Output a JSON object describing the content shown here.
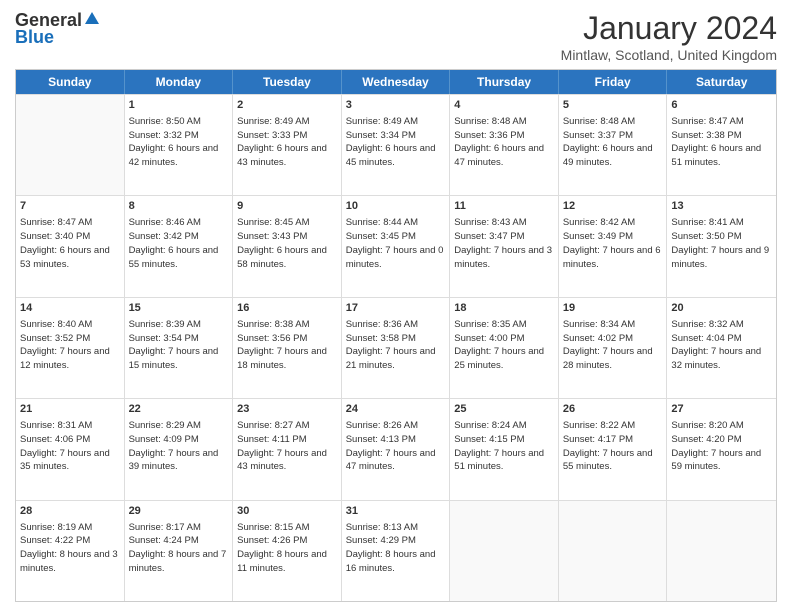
{
  "header": {
    "logo_general": "General",
    "logo_blue": "Blue",
    "month_title": "January 2024",
    "subtitle": "Mintlaw, Scotland, United Kingdom"
  },
  "days": [
    "Sunday",
    "Monday",
    "Tuesday",
    "Wednesday",
    "Thursday",
    "Friday",
    "Saturday"
  ],
  "weeks": [
    [
      {
        "num": "",
        "empty": true
      },
      {
        "num": "1",
        "sunrise": "Sunrise: 8:50 AM",
        "sunset": "Sunset: 3:32 PM",
        "daylight": "Daylight: 6 hours and 42 minutes."
      },
      {
        "num": "2",
        "sunrise": "Sunrise: 8:49 AM",
        "sunset": "Sunset: 3:33 PM",
        "daylight": "Daylight: 6 hours and 43 minutes."
      },
      {
        "num": "3",
        "sunrise": "Sunrise: 8:49 AM",
        "sunset": "Sunset: 3:34 PM",
        "daylight": "Daylight: 6 hours and 45 minutes."
      },
      {
        "num": "4",
        "sunrise": "Sunrise: 8:48 AM",
        "sunset": "Sunset: 3:36 PM",
        "daylight": "Daylight: 6 hours and 47 minutes."
      },
      {
        "num": "5",
        "sunrise": "Sunrise: 8:48 AM",
        "sunset": "Sunset: 3:37 PM",
        "daylight": "Daylight: 6 hours and 49 minutes."
      },
      {
        "num": "6",
        "sunrise": "Sunrise: 8:47 AM",
        "sunset": "Sunset: 3:38 PM",
        "daylight": "Daylight: 6 hours and 51 minutes."
      }
    ],
    [
      {
        "num": "7",
        "sunrise": "Sunrise: 8:47 AM",
        "sunset": "Sunset: 3:40 PM",
        "daylight": "Daylight: 6 hours and 53 minutes."
      },
      {
        "num": "8",
        "sunrise": "Sunrise: 8:46 AM",
        "sunset": "Sunset: 3:42 PM",
        "daylight": "Daylight: 6 hours and 55 minutes."
      },
      {
        "num": "9",
        "sunrise": "Sunrise: 8:45 AM",
        "sunset": "Sunset: 3:43 PM",
        "daylight": "Daylight: 6 hours and 58 minutes."
      },
      {
        "num": "10",
        "sunrise": "Sunrise: 8:44 AM",
        "sunset": "Sunset: 3:45 PM",
        "daylight": "Daylight: 7 hours and 0 minutes."
      },
      {
        "num": "11",
        "sunrise": "Sunrise: 8:43 AM",
        "sunset": "Sunset: 3:47 PM",
        "daylight": "Daylight: 7 hours and 3 minutes."
      },
      {
        "num": "12",
        "sunrise": "Sunrise: 8:42 AM",
        "sunset": "Sunset: 3:49 PM",
        "daylight": "Daylight: 7 hours and 6 minutes."
      },
      {
        "num": "13",
        "sunrise": "Sunrise: 8:41 AM",
        "sunset": "Sunset: 3:50 PM",
        "daylight": "Daylight: 7 hours and 9 minutes."
      }
    ],
    [
      {
        "num": "14",
        "sunrise": "Sunrise: 8:40 AM",
        "sunset": "Sunset: 3:52 PM",
        "daylight": "Daylight: 7 hours and 12 minutes."
      },
      {
        "num": "15",
        "sunrise": "Sunrise: 8:39 AM",
        "sunset": "Sunset: 3:54 PM",
        "daylight": "Daylight: 7 hours and 15 minutes."
      },
      {
        "num": "16",
        "sunrise": "Sunrise: 8:38 AM",
        "sunset": "Sunset: 3:56 PM",
        "daylight": "Daylight: 7 hours and 18 minutes."
      },
      {
        "num": "17",
        "sunrise": "Sunrise: 8:36 AM",
        "sunset": "Sunset: 3:58 PM",
        "daylight": "Daylight: 7 hours and 21 minutes."
      },
      {
        "num": "18",
        "sunrise": "Sunrise: 8:35 AM",
        "sunset": "Sunset: 4:00 PM",
        "daylight": "Daylight: 7 hours and 25 minutes."
      },
      {
        "num": "19",
        "sunrise": "Sunrise: 8:34 AM",
        "sunset": "Sunset: 4:02 PM",
        "daylight": "Daylight: 7 hours and 28 minutes."
      },
      {
        "num": "20",
        "sunrise": "Sunrise: 8:32 AM",
        "sunset": "Sunset: 4:04 PM",
        "daylight": "Daylight: 7 hours and 32 minutes."
      }
    ],
    [
      {
        "num": "21",
        "sunrise": "Sunrise: 8:31 AM",
        "sunset": "Sunset: 4:06 PM",
        "daylight": "Daylight: 7 hours and 35 minutes."
      },
      {
        "num": "22",
        "sunrise": "Sunrise: 8:29 AM",
        "sunset": "Sunset: 4:09 PM",
        "daylight": "Daylight: 7 hours and 39 minutes."
      },
      {
        "num": "23",
        "sunrise": "Sunrise: 8:27 AM",
        "sunset": "Sunset: 4:11 PM",
        "daylight": "Daylight: 7 hours and 43 minutes."
      },
      {
        "num": "24",
        "sunrise": "Sunrise: 8:26 AM",
        "sunset": "Sunset: 4:13 PM",
        "daylight": "Daylight: 7 hours and 47 minutes."
      },
      {
        "num": "25",
        "sunrise": "Sunrise: 8:24 AM",
        "sunset": "Sunset: 4:15 PM",
        "daylight": "Daylight: 7 hours and 51 minutes."
      },
      {
        "num": "26",
        "sunrise": "Sunrise: 8:22 AM",
        "sunset": "Sunset: 4:17 PM",
        "daylight": "Daylight: 7 hours and 55 minutes."
      },
      {
        "num": "27",
        "sunrise": "Sunrise: 8:20 AM",
        "sunset": "Sunset: 4:20 PM",
        "daylight": "Daylight: 7 hours and 59 minutes."
      }
    ],
    [
      {
        "num": "28",
        "sunrise": "Sunrise: 8:19 AM",
        "sunset": "Sunset: 4:22 PM",
        "daylight": "Daylight: 8 hours and 3 minutes."
      },
      {
        "num": "29",
        "sunrise": "Sunrise: 8:17 AM",
        "sunset": "Sunset: 4:24 PM",
        "daylight": "Daylight: 8 hours and 7 minutes."
      },
      {
        "num": "30",
        "sunrise": "Sunrise: 8:15 AM",
        "sunset": "Sunset: 4:26 PM",
        "daylight": "Daylight: 8 hours and 11 minutes."
      },
      {
        "num": "31",
        "sunrise": "Sunrise: 8:13 AM",
        "sunset": "Sunset: 4:29 PM",
        "daylight": "Daylight: 8 hours and 16 minutes."
      },
      {
        "num": "",
        "empty": true
      },
      {
        "num": "",
        "empty": true
      },
      {
        "num": "",
        "empty": true
      }
    ]
  ]
}
